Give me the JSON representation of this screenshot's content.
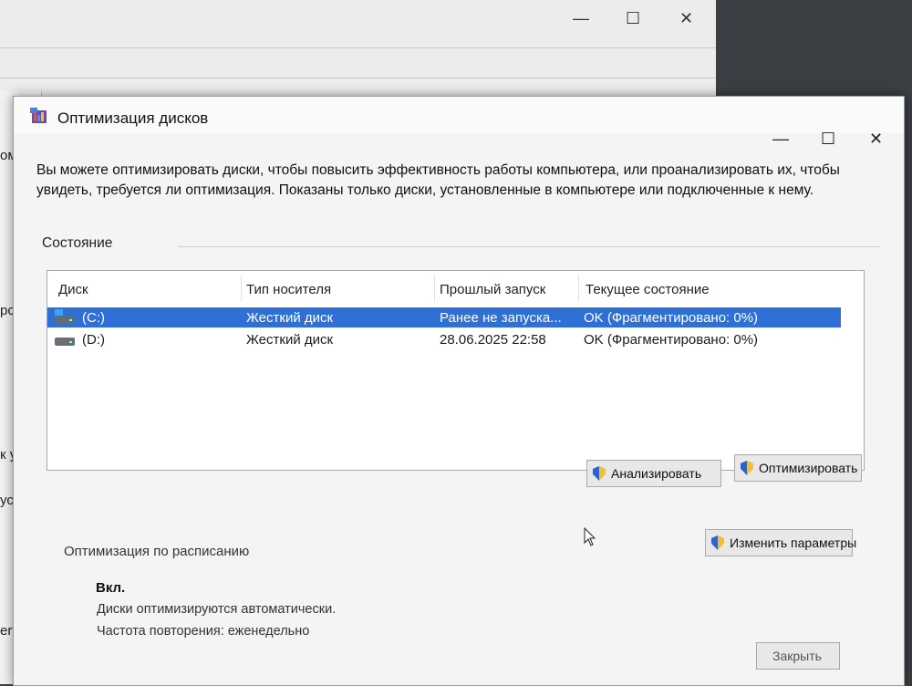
{
  "background_window": {
    "controls": [
      "—",
      "☐",
      "✕"
    ]
  },
  "left_window": {
    "fragments": [
      "омп",
      "ройс",
      "к устр",
      "устро",
      "erface D"
    ]
  },
  "dialog": {
    "title": "Оптимизация дисков",
    "description": "Вы можете оптимизировать диски, чтобы повысить эффективность работы  компьютера, или проанализировать их, чтобы увидеть, требуется ли оптимизация. Показаны только диски, установленные в компьютере или подключенные к нему.",
    "status_section": "Состояние",
    "columns": [
      "Диск",
      "Тип носителя",
      "Прошлый запуск",
      "Текущее состояние"
    ],
    "drives": [
      {
        "name": "(C:)",
        "media": "Жесткий диск",
        "last_run": "Ранее не запуска...",
        "status": "OK (Фрагментировано: 0%)",
        "selected": true,
        "icon": "system-drive-icon"
      },
      {
        "name": "(D:)",
        "media": "Жесткий диск",
        "last_run": "28.06.2025 22:58",
        "status": "OK (Фрагментировано: 0%)",
        "selected": false,
        "icon": "drive-icon"
      }
    ],
    "buttons": {
      "analyze": "Анализировать",
      "optimize": "Оптимизировать",
      "change_settings": "Изменить параметры",
      "close": "Закрыть"
    },
    "schedule": {
      "label": "Оптимизация по расписанию",
      "status": "Вкл.",
      "line1": "Диски оптимизируются автоматически.",
      "line2": "Частота повторения: еженедельно"
    },
    "window_controls": [
      "—",
      "☐",
      "✕"
    ]
  },
  "colors": {
    "selection": "#2f70d6",
    "dialog_bg": "#f4f4f4",
    "desktop": "#3a3f43"
  }
}
